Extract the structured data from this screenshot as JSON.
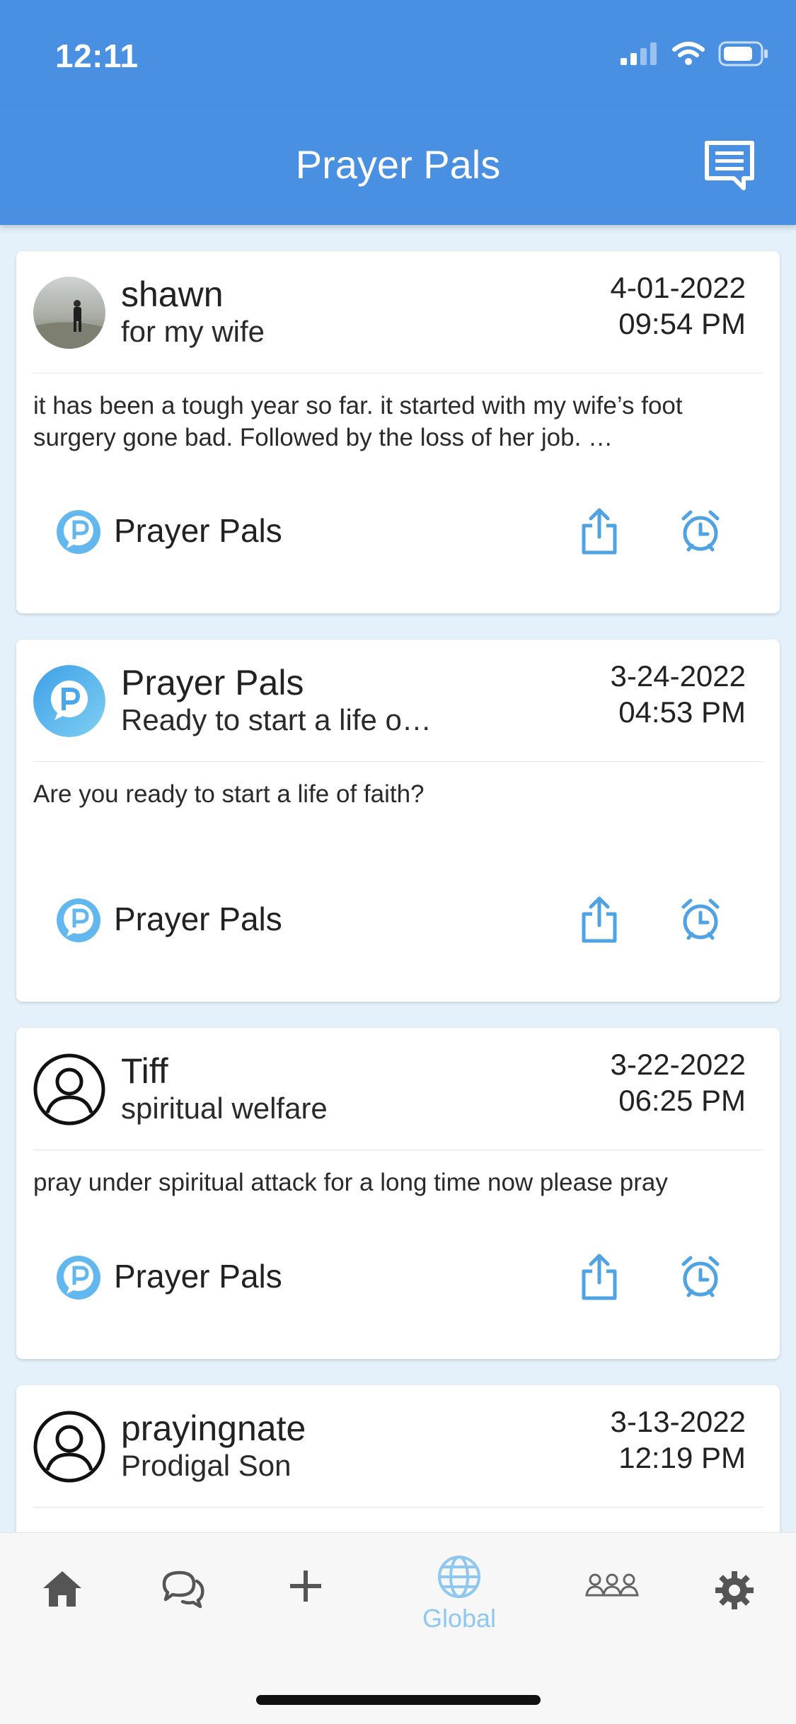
{
  "status_bar": {
    "time": "12:11"
  },
  "header": {
    "title": "Prayer Pals",
    "message_icon": "message-icon"
  },
  "posts": [
    {
      "name": "shawn",
      "subject": "for my wife",
      "date": "4-01-2022",
      "time": "09:54 PM",
      "body": "it has been a tough year so far. it started with my wife’s foot surgery gone bad. Followed by the loss of her job. …",
      "group": "Prayer Pals",
      "avatar": "photo"
    },
    {
      "name": "Prayer Pals",
      "subject": "Ready to start a life o…",
      "date": "3-24-2022",
      "time": "04:53 PM",
      "body": "Are you ready to start a life of faith?",
      "group": "Prayer Pals",
      "avatar": "logo"
    },
    {
      "name": "Tiff",
      "subject": "spiritual welfare",
      "date": "3-22-2022",
      "time": "06:25 PM",
      "body": "pray under spiritual attack for a long time now please pray",
      "group": "Prayer Pals",
      "avatar": "person"
    },
    {
      "name": "prayingnate",
      "subject": "Prodigal Son",
      "date": "3-13-2022",
      "time": "12:19 PM",
      "body": "",
      "group": "",
      "avatar": "person"
    }
  ],
  "tabs": [
    {
      "icon": "home-icon",
      "label": ""
    },
    {
      "icon": "chat-icon",
      "label": ""
    },
    {
      "icon": "add-icon",
      "label": ""
    },
    {
      "icon": "globe-icon",
      "label": "Global"
    },
    {
      "icon": "group-icon",
      "label": ""
    },
    {
      "icon": "settings-icon",
      "label": ""
    }
  ],
  "colors": {
    "primary": "#4a90e2",
    "accent": "#4fa3e3",
    "active_tab": "#8ec7f0",
    "background": "#e4f1fb"
  }
}
